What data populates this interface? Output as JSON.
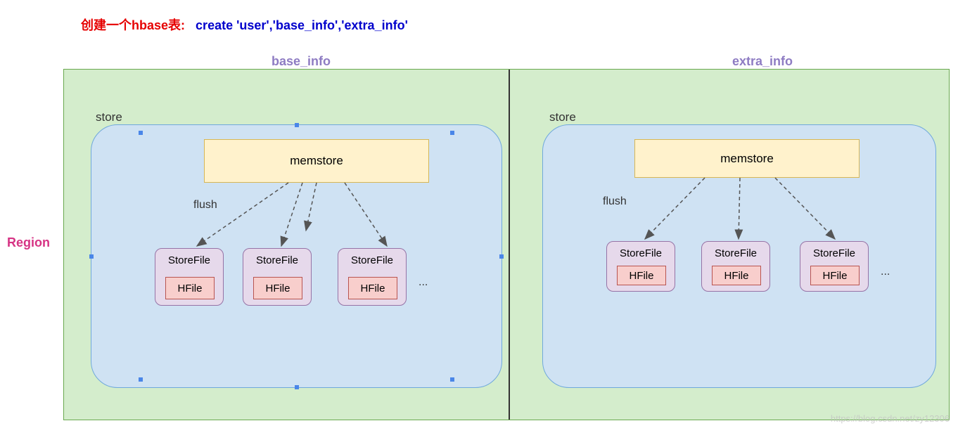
{
  "title": {
    "red_text": "创建一个hbase表:",
    "blue_text": "create  'user','base_info','extra_info'"
  },
  "region_label": "Region",
  "column_families": {
    "left": "base_info",
    "right": "extra_info"
  },
  "store": {
    "label": "store",
    "memstore_label": "memstore",
    "flush_label": "flush",
    "storefile_label": "StoreFile",
    "hfile_label": "HFile",
    "ellipsis": "...",
    "left_storefiles_count": 3,
    "right_storefiles_count": 3
  },
  "watermark": "https://blog.csdn.net/zy12306"
}
